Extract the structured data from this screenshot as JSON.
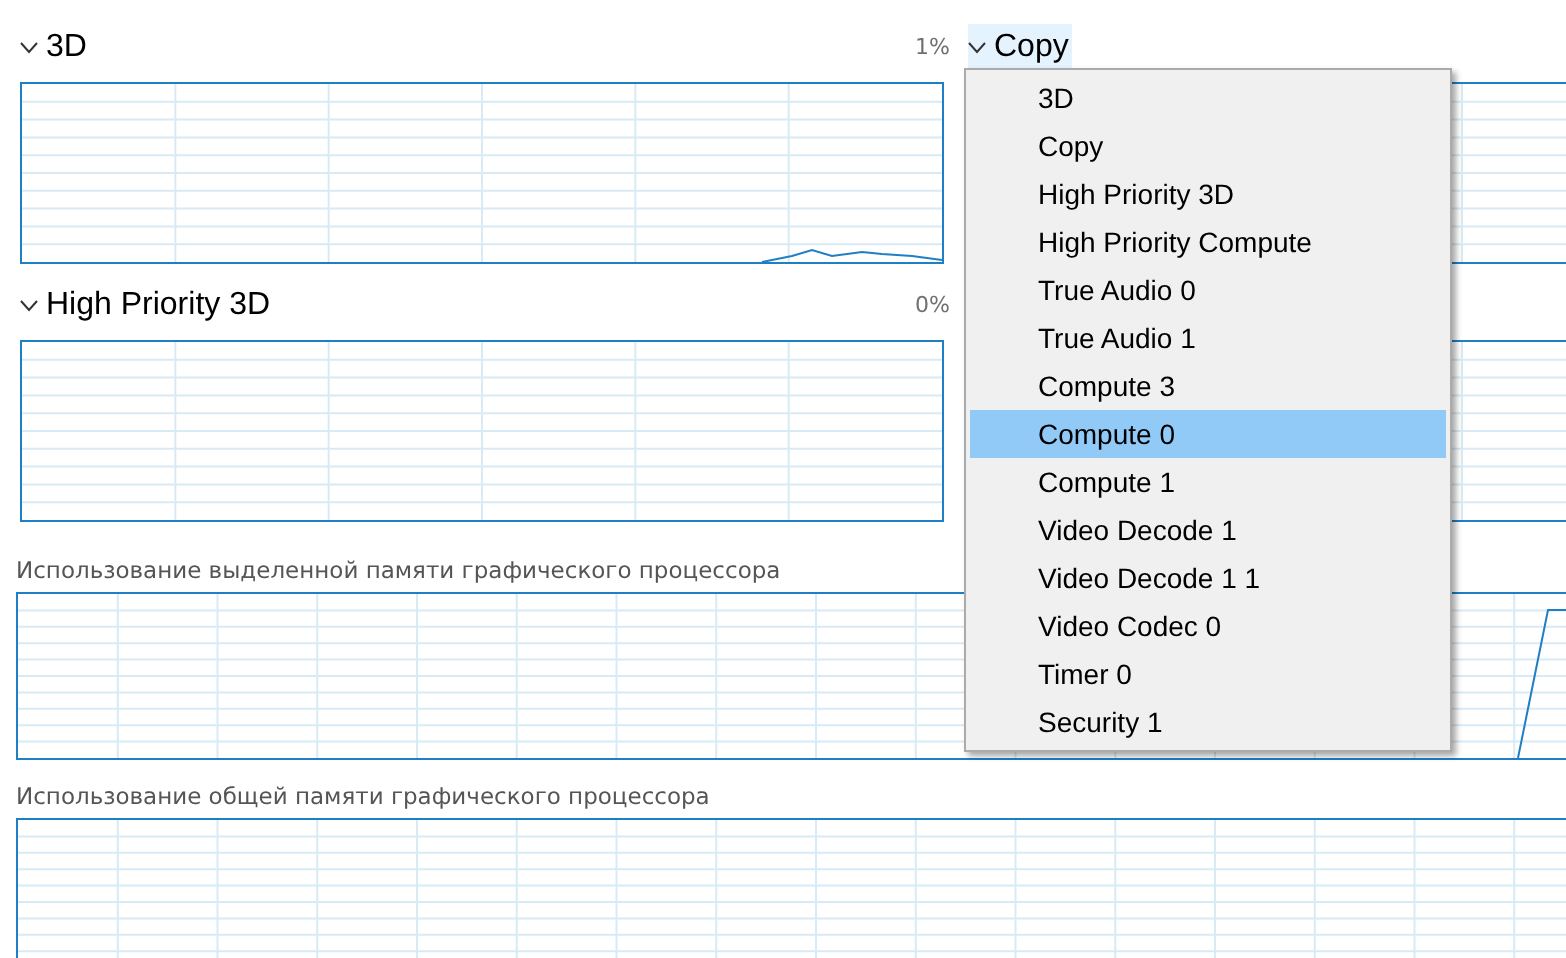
{
  "engines": [
    {
      "title": "3D",
      "percent": "1%",
      "expanded": true
    },
    {
      "title": "High Priority 3D",
      "percent": "0%",
      "expanded": true
    }
  ],
  "selector": {
    "title": "Copy",
    "expanded": true
  },
  "memory_sections": [
    {
      "label": "Использование выделенной памяти графического процессора"
    },
    {
      "label": "Использование общей памяти графического процессора"
    }
  ],
  "menu": [
    {
      "label": "3D",
      "selected": false
    },
    {
      "label": "Copy",
      "selected": false
    },
    {
      "label": "High Priority 3D",
      "selected": false
    },
    {
      "label": "High Priority Compute",
      "selected": false
    },
    {
      "label": "True Audio 0",
      "selected": false
    },
    {
      "label": "True Audio 1",
      "selected": false
    },
    {
      "label": "Compute 3",
      "selected": false
    },
    {
      "label": "Compute 0",
      "selected": true
    },
    {
      "label": "Compute 1",
      "selected": false
    },
    {
      "label": "Video Decode 1",
      "selected": false
    },
    {
      "label": "Video Decode 1 1",
      "selected": false
    },
    {
      "label": "Video Codec 0",
      "selected": false
    },
    {
      "label": "Timer 0",
      "selected": false
    },
    {
      "label": "Security 1",
      "selected": false
    }
  ]
}
